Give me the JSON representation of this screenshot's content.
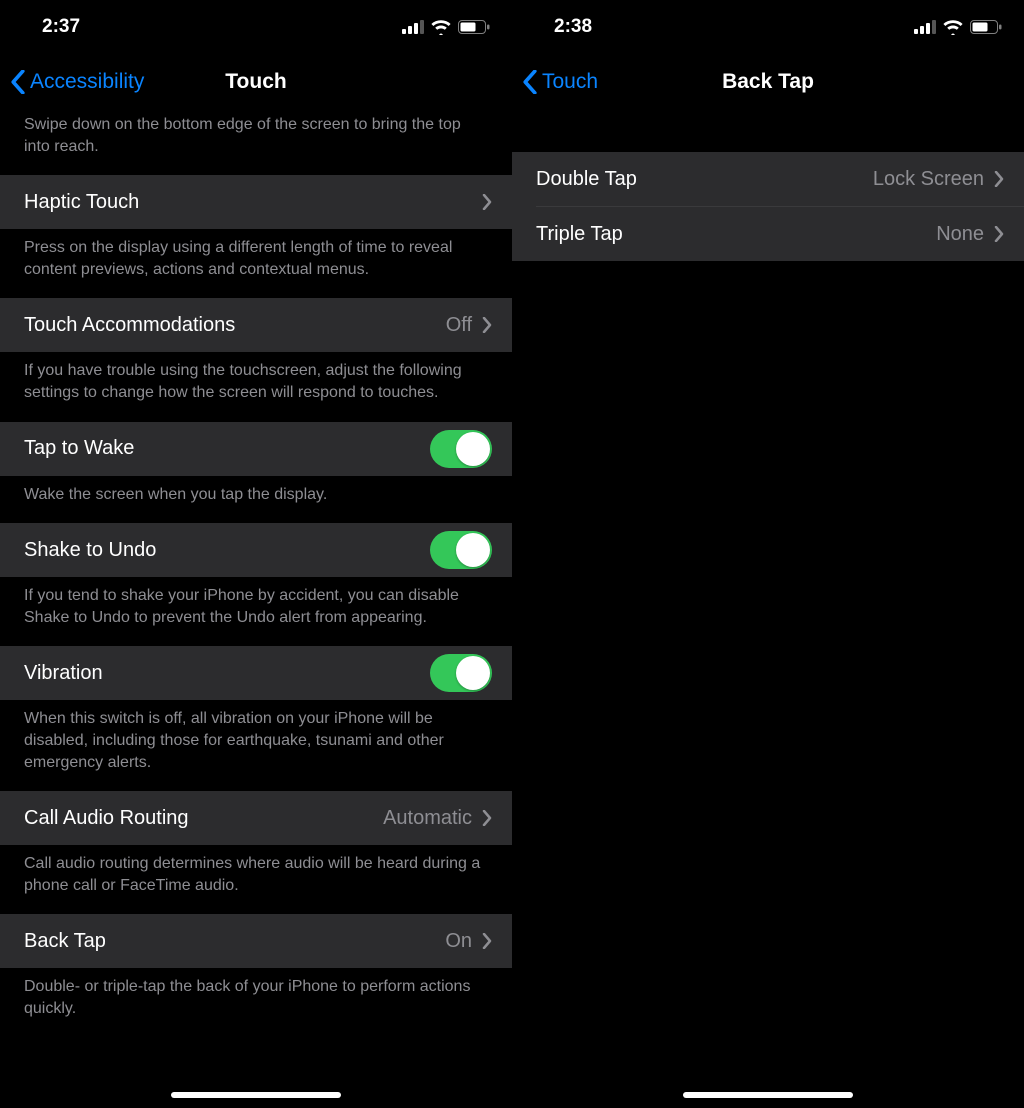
{
  "left": {
    "status": {
      "time": "2:37"
    },
    "nav": {
      "back": "Accessibility",
      "title": "Touch"
    },
    "reachability_footer": "Swipe down on the bottom edge of the screen to bring the top into reach.",
    "haptic_touch": {
      "label": "Haptic Touch"
    },
    "haptic_touch_footer": "Press on the display using a different length of time to reveal content previews, actions and contextual menus.",
    "touch_accommodations": {
      "label": "Touch Accommodations",
      "value": "Off"
    },
    "touch_accommodations_footer": "If you have trouble using the touchscreen, adjust the following settings to change how the screen will respond to touches.",
    "tap_to_wake": {
      "label": "Tap to Wake"
    },
    "tap_to_wake_footer": "Wake the screen when you tap the display.",
    "shake_to_undo": {
      "label": "Shake to Undo"
    },
    "shake_to_undo_footer": "If you tend to shake your iPhone by accident, you can disable Shake to Undo to prevent the Undo alert from appearing.",
    "vibration": {
      "label": "Vibration"
    },
    "vibration_footer": "When this switch is off, all vibration on your iPhone will be disabled, including those for earthquake, tsunami and other emergency alerts.",
    "call_audio_routing": {
      "label": "Call Audio Routing",
      "value": "Automatic"
    },
    "call_audio_routing_footer": "Call audio routing determines where audio will be heard during a phone call or FaceTime audio.",
    "back_tap": {
      "label": "Back Tap",
      "value": "On"
    },
    "back_tap_footer": "Double- or triple-tap the back of your iPhone to perform actions quickly."
  },
  "right": {
    "status": {
      "time": "2:38"
    },
    "nav": {
      "back": "Touch",
      "title": "Back Tap"
    },
    "double_tap": {
      "label": "Double Tap",
      "value": "Lock Screen"
    },
    "triple_tap": {
      "label": "Triple Tap",
      "value": "None"
    }
  }
}
